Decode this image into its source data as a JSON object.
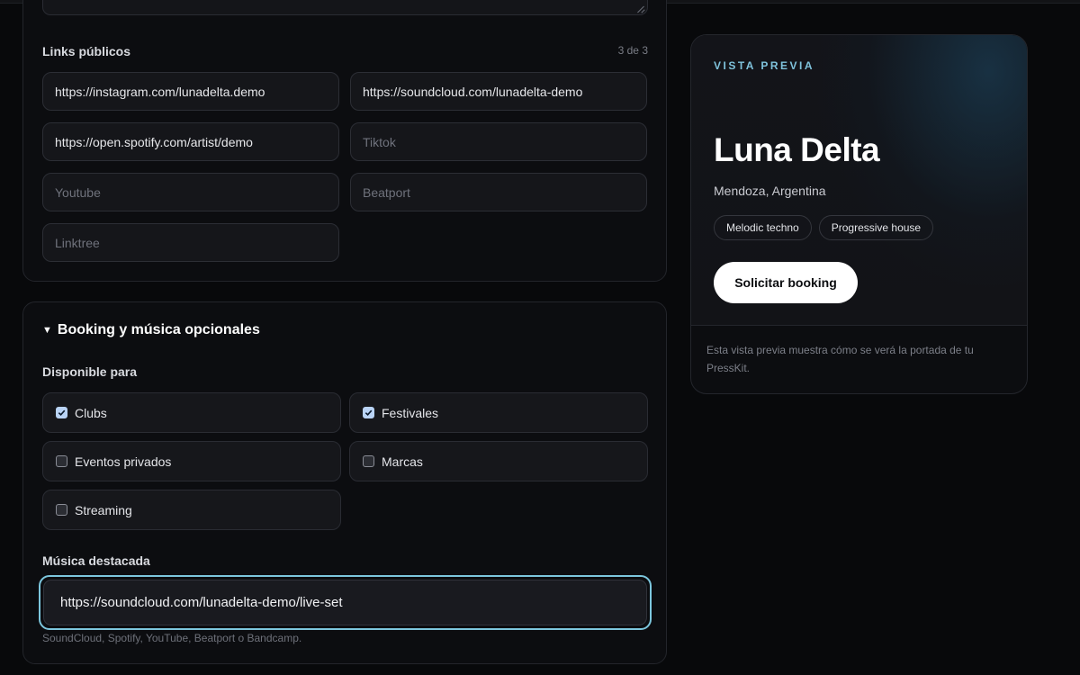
{
  "links": {
    "title": "Links públicos",
    "counter": "3 de 3",
    "fields": [
      {
        "value": "https://instagram.com/lunadelta.demo",
        "placeholder": ""
      },
      {
        "value": "https://soundcloud.com/lunadelta-demo",
        "placeholder": ""
      },
      {
        "value": "https://open.spotify.com/artist/demo",
        "placeholder": ""
      },
      {
        "value": "",
        "placeholder": "Tiktok"
      },
      {
        "value": "",
        "placeholder": "Youtube"
      },
      {
        "value": "",
        "placeholder": "Beatport"
      },
      {
        "value": "",
        "placeholder": "Linktree"
      }
    ]
  },
  "booking": {
    "title": "Booking y música opcionales",
    "available_label": "Disponible para",
    "options": [
      {
        "label": "Clubs",
        "checked": true
      },
      {
        "label": "Festivales",
        "checked": true
      },
      {
        "label": "Eventos privados",
        "checked": false
      },
      {
        "label": "Marcas",
        "checked": false
      },
      {
        "label": "Streaming",
        "checked": false
      }
    ],
    "music_label": "Música destacada",
    "music_value": "https://soundcloud.com/lunadelta-demo/live-set",
    "music_hint": "SoundCloud, Spotify, YouTube, Beatport o Bandcamp."
  },
  "preview": {
    "eyebrow": "VISTA PREVIA",
    "artist": "Luna Delta",
    "location": "Mendoza, Argentina",
    "tags": [
      "Melodic techno",
      "Progressive house"
    ],
    "cta": "Solicitar booking",
    "note": "Esta vista previa muestra cómo se verá la portada de tu PressKit."
  },
  "colors": {
    "accent": "#7cc6dd",
    "checkbox_on": "#b9d3f5",
    "background": "#08090b"
  }
}
